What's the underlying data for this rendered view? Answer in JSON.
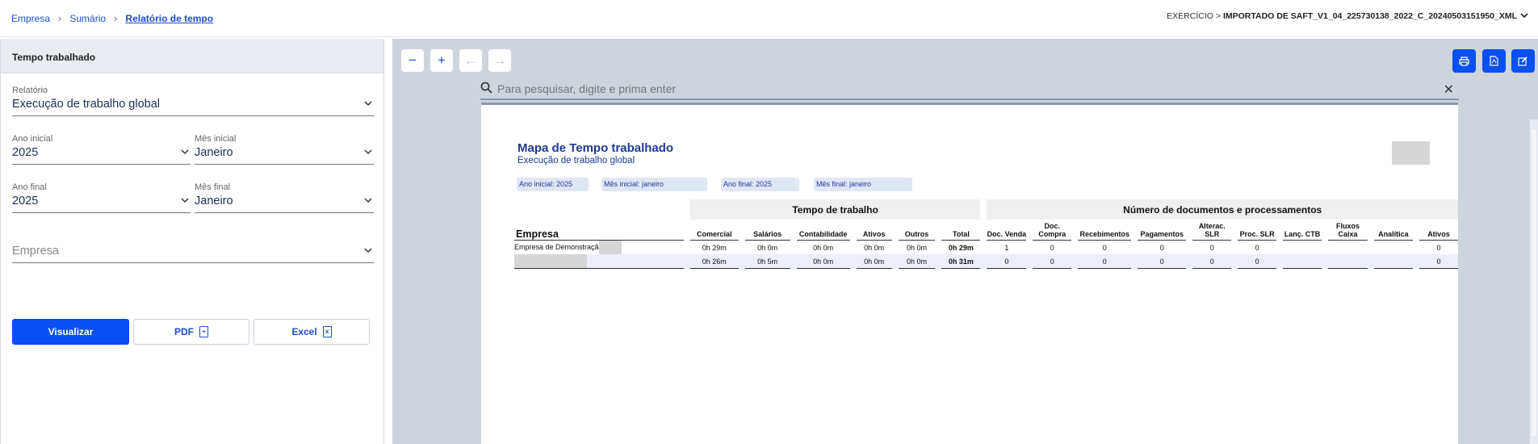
{
  "breadcrumb": [
    "Empresa",
    "Sumário",
    "Relatório de tempo"
  ],
  "exercise": {
    "label": "EXERCÍCIO >",
    "value": "IMPORTADO DE SAFT_V1_04_225730138_2022_C_20240503151950_XML"
  },
  "panel": {
    "title": "Tempo trabalhado",
    "relatorio": {
      "label": "Relatório",
      "value": "Execução de trabalho global"
    },
    "ano_inicial": {
      "label": "Ano inicial",
      "value": "2025"
    },
    "mes_inicial": {
      "label": "Mês inicial",
      "value": "Janeiro"
    },
    "ano_final": {
      "label": "Ano final",
      "value": "2025"
    },
    "mes_final": {
      "label": "Mês final",
      "value": "Janeiro"
    },
    "empresa": {
      "placeholder": "Empresa"
    },
    "buttons": {
      "visualizar": "Visualizar",
      "pdf": "PDF",
      "excel": "Excel"
    }
  },
  "viewer": {
    "search_placeholder": "Para pesquisar, digite e prima enter",
    "toolbar_icons": [
      "zoom-out-icon",
      "zoom-in-icon",
      "arrow-left-icon",
      "arrow-right-icon",
      "print-icon",
      "pdf-icon",
      "edit-icon"
    ]
  },
  "report": {
    "title": "Mapa de Tempo trabalhado",
    "subtitle": "Execução de trabalho global",
    "filters": [
      "Ano inicial: 2025",
      "Mês inicial: janeiro",
      "Ano final: 2025",
      "Mês final: janeiro"
    ],
    "group_time": "Tempo de trabalho",
    "group_docs": "Número de documentos e processamentos",
    "empresa_header": "Empresa",
    "time_headers": [
      "Comercial",
      "Salários",
      "Contabilidade",
      "Ativos",
      "Outros",
      "Total"
    ],
    "doc_headers": [
      "Doc. Venda",
      "Doc. Compra",
      "Recebimentos",
      "Pagamentos",
      "Alterac. SLR",
      "Proc. SLR",
      "Lanç. CTB",
      "Fluxos Caixa",
      "Analítica",
      "Ativos"
    ],
    "rows": [
      {
        "empresa": "Empresa de Demonstraçã",
        "time": [
          "0h 29m",
          "0h 0m",
          "0h 0m",
          "0h 0m",
          "0h 0m",
          "0h 29m"
        ],
        "docs": [
          "1",
          "0",
          "0",
          "0",
          "0",
          "0",
          "",
          "",
          "",
          "0"
        ]
      },
      {
        "empresa": "",
        "time": [
          "0h 26m",
          "0h 5m",
          "0h 0m",
          "0h 0m",
          "0h 0m",
          "0h 31m"
        ],
        "docs": [
          "0",
          "0",
          "0",
          "0",
          "0",
          "0",
          "",
          "",
          "",
          "0"
        ]
      }
    ]
  },
  "colors": {
    "primary": "#0a4ff2",
    "link": "#1a4fc4",
    "report_title": "#1e3a94",
    "viewer_bg": "#cdd4dc"
  }
}
